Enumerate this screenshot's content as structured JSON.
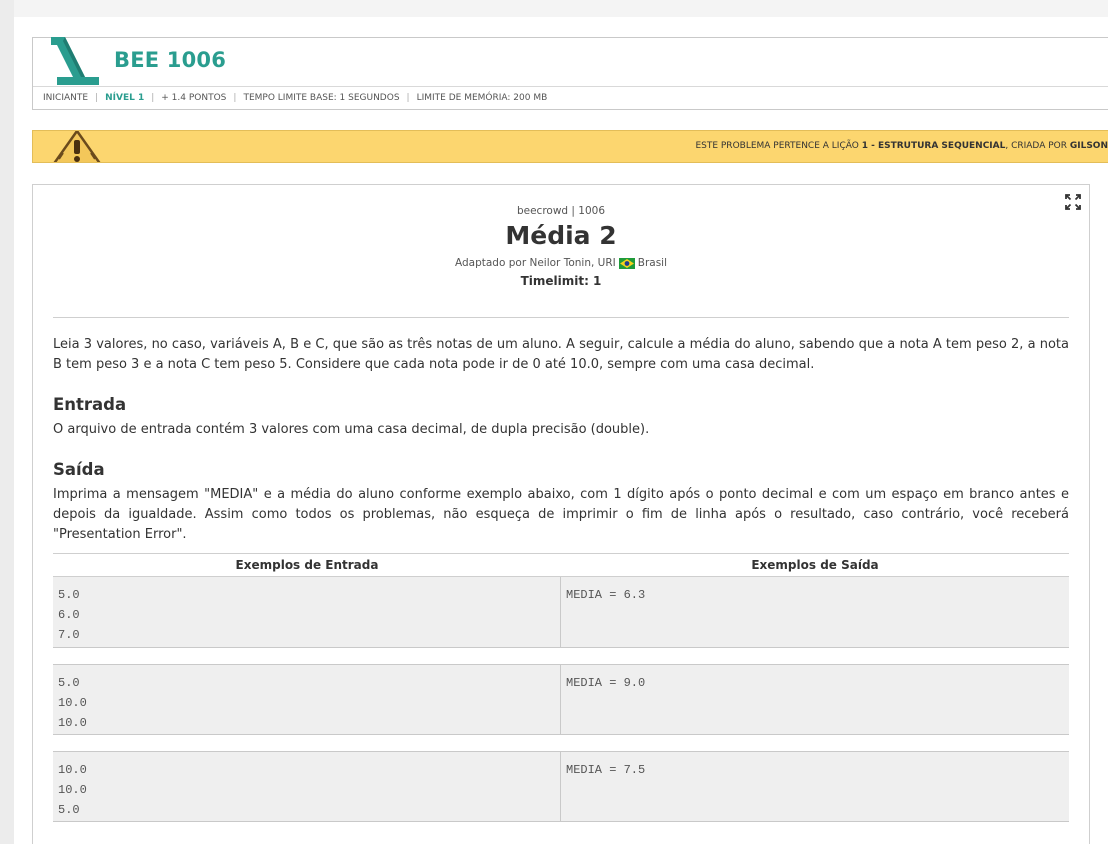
{
  "header": {
    "title": "BEE 1006",
    "meta": {
      "category": "INICIANTE",
      "level": "NÍVEL 1",
      "points": "+ 1.4 PONTOS",
      "time_limit": "TEMPO LIMITE BASE: 1 SEGUNDOS",
      "memory_limit": "LIMITE DE MEMÓRIA: 200 MB"
    }
  },
  "banner": {
    "prefix": "ESTE PROBLEMA PERTENCE A LIÇÃO ",
    "lesson": "1 - ESTRUTURA SEQUENCIAL",
    "middle": ", CRIADA POR ",
    "author": "GILSON"
  },
  "problem": {
    "source": "beecrowd | 1006",
    "title": "Média 2",
    "adapted_by": "Adaptado por Neilor Tonin, URI",
    "country": "Brasil",
    "timelimit": "Timelimit: 1",
    "description": "Leia 3 valores, no caso, variáveis A, B e C, que são as três notas de um aluno. A seguir, calcule a média do aluno, sabendo que a nota A tem peso 2, a nota B tem peso 3 e a nota C tem peso 5. Considere que cada nota pode ir de 0 até 10.0, sempre com uma casa decimal.",
    "input_heading": "Entrada",
    "input_text": "O arquivo de entrada contém 3 valores com uma casa decimal, de dupla precisão (double).",
    "output_heading": "Saída",
    "output_text": "Imprima a mensagem \"MEDIA\" e a média do aluno conforme exemplo abaixo, com 1 dígito após o ponto decimal e com um espaço em branco antes e depois da igualdade. Assim como todos os problemas, não esqueça de imprimir o fim de linha após o resultado, caso contrário, você receberá \"Presentation Error\"."
  },
  "examples": {
    "input_header": "Exemplos de Entrada",
    "output_header": "Exemplos de Saída",
    "rows": [
      {
        "input": "5.0\n6.0\n7.0",
        "output": "MEDIA = 6.3"
      },
      {
        "input": "5.0\n10.0\n10.0",
        "output": "MEDIA = 9.0"
      },
      {
        "input": "10.0\n10.0\n5.0",
        "output": "MEDIA = 7.5"
      }
    ]
  },
  "colors": {
    "accent": "#2a9d8f",
    "banner": "#fcd66f"
  }
}
